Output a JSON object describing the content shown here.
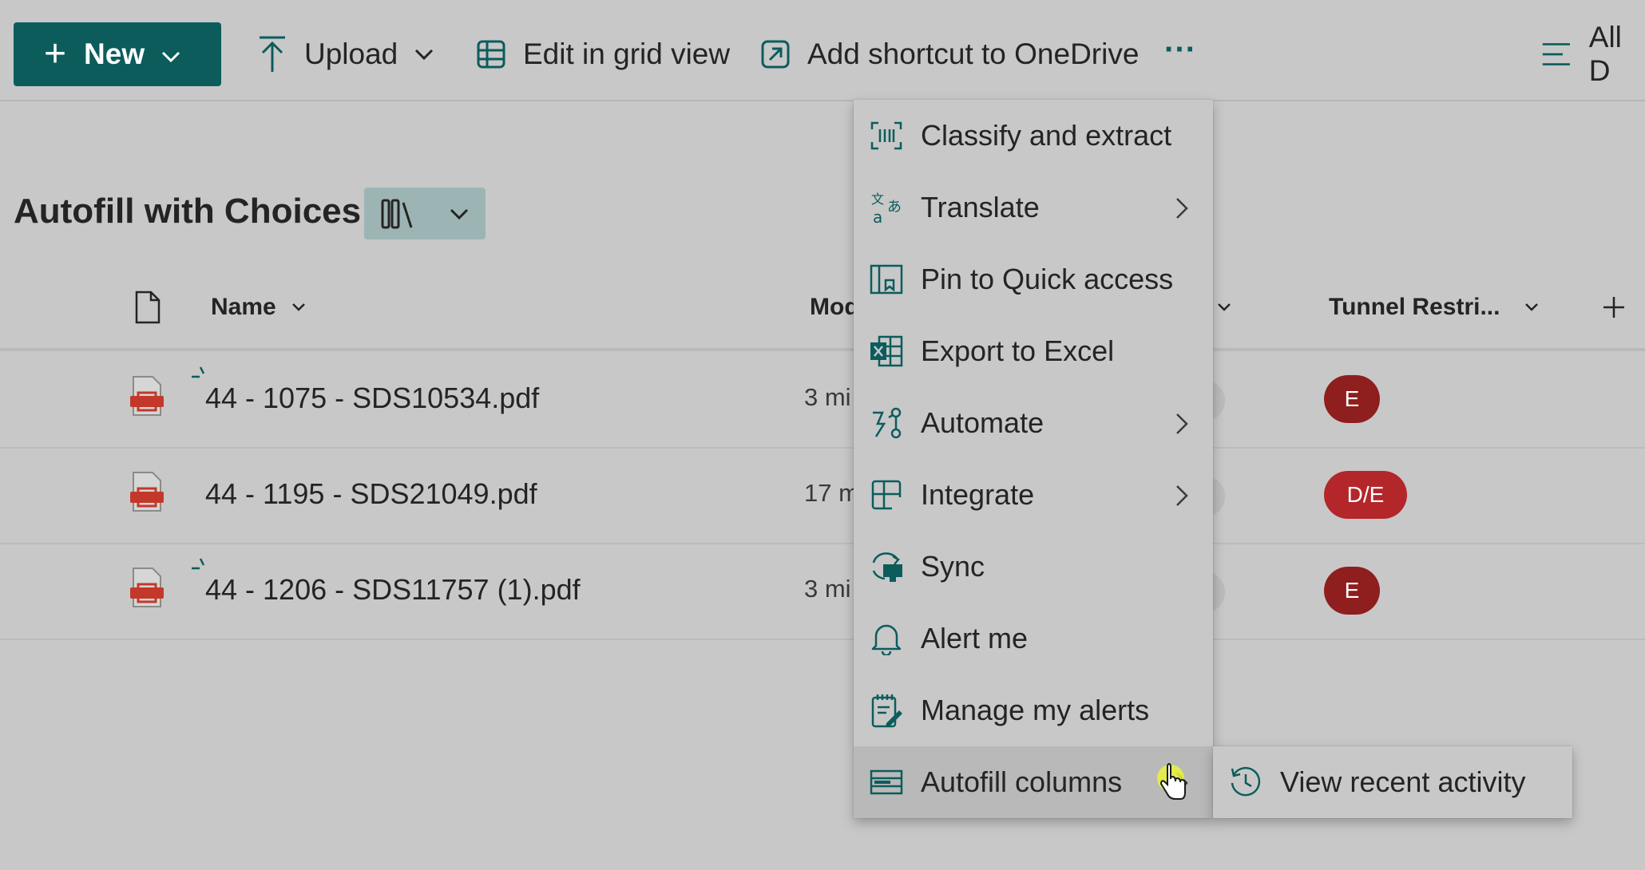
{
  "colors": {
    "brand": "#0c5c5c",
    "icon": "#0c5c5c",
    "badge_e": "#8f1e1e",
    "badge_de": "#b3262a",
    "pdf_red": "#c4382a",
    "cursor_yellow": "#e9f23b"
  },
  "commandbar": {
    "new_label": "New",
    "upload_label": "Upload",
    "grid_label": "Edit in grid view",
    "shortcut_label": "Add shortcut to OneDrive",
    "more_label": "···",
    "view_label": "All D"
  },
  "library": {
    "title": "Autofill with Choices",
    "columns": {
      "name": "Name",
      "modified": "Mod",
      "tunnel": "Tunnel Restri..."
    },
    "rows": [
      {
        "name": "44 - 1075 - SDS10534.pdf",
        "modified": "3 mi",
        "badge": "E",
        "new": true
      },
      {
        "name": "44 - 1195 - SDS21049.pdf",
        "modified": "17 m",
        "badge": "D/E",
        "new": false
      },
      {
        "name": "44 - 1206 - SDS11757 (1).pdf",
        "modified": "3 mi",
        "badge": "E",
        "new": true
      }
    ]
  },
  "menu": {
    "items": [
      {
        "label": "Classify and extract",
        "icon": "classify-icon",
        "submenu": false
      },
      {
        "label": "Translate",
        "icon": "translate-icon",
        "submenu": true
      },
      {
        "label": "Pin to Quick access",
        "icon": "pin-icon",
        "submenu": false
      },
      {
        "label": "Export to Excel",
        "icon": "excel-icon",
        "submenu": false
      },
      {
        "label": "Automate",
        "icon": "automate-icon",
        "submenu": true
      },
      {
        "label": "Integrate",
        "icon": "integrate-icon",
        "submenu": true
      },
      {
        "label": "Sync",
        "icon": "sync-icon",
        "submenu": false
      },
      {
        "label": "Alert me",
        "icon": "bell-icon",
        "submenu": false
      },
      {
        "label": "Manage my alerts",
        "icon": "manage-alerts-icon",
        "submenu": false
      },
      {
        "label": "Autofill columns",
        "icon": "autofill-icon",
        "submenu": true
      }
    ],
    "submenu_items": [
      {
        "label": "View recent activity",
        "icon": "history-icon"
      }
    ]
  }
}
